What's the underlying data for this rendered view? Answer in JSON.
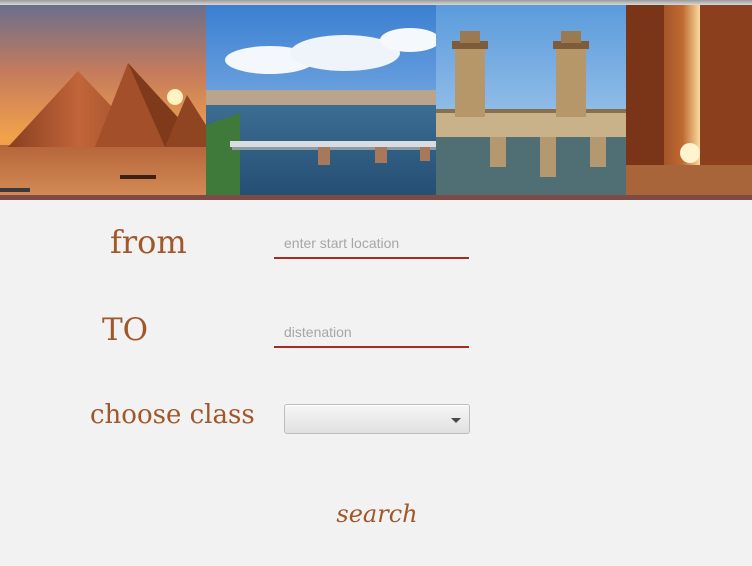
{
  "banner": {
    "image_names": [
      "pyramids-image",
      "nile-bridge-image",
      "stanley-bridge-image",
      "karnak-columns-image"
    ]
  },
  "form": {
    "from_label": "from",
    "from_placeholder": "enter start location",
    "to_label": "TO",
    "to_placeholder": "distenation",
    "class_label": "choose class",
    "class_selected": "",
    "search_label": "search"
  },
  "colors": {
    "label": "#a0572a",
    "underline": "#a82b23",
    "background": "#f3f2f2",
    "banner_border": "#7e4a45"
  }
}
